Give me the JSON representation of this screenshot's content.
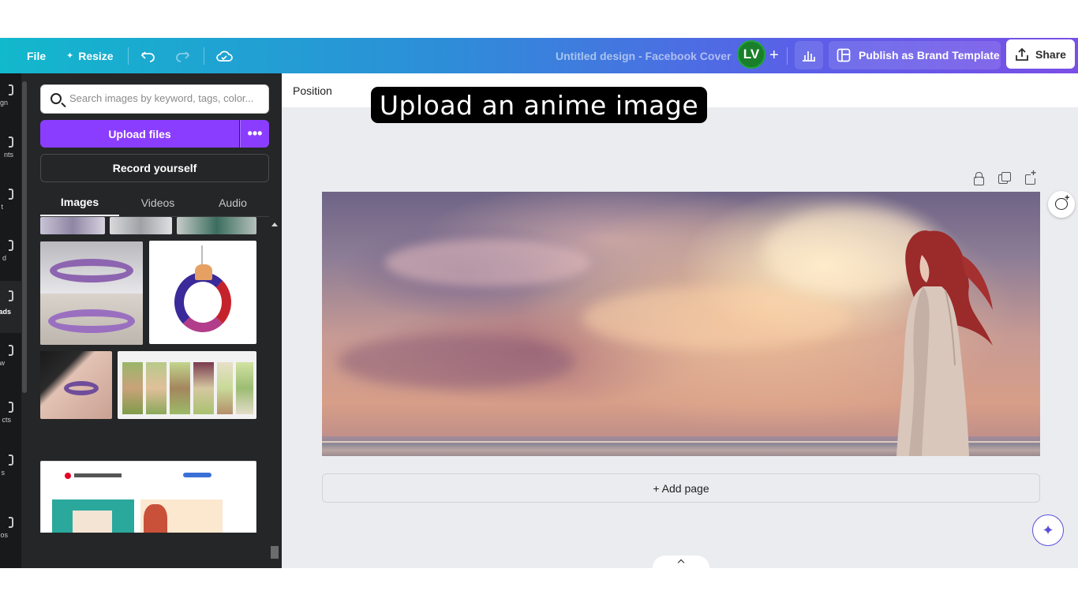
{
  "topbar": {
    "file_label": "File",
    "resize_label": "Resize",
    "design_title": "Untitled design - Facebook Cover",
    "avatar_initials": "LV",
    "publish_label": "Publish as Brand Template",
    "share_label": "Share"
  },
  "rail": {
    "items": [
      "gn",
      "nts",
      "t",
      "d",
      "ads",
      "w",
      "cts",
      "s",
      "os"
    ],
    "active_index": 4
  },
  "panel": {
    "search_placeholder": "Search images by keyword, tags, color...",
    "upload_label": "Upload files",
    "more_label": "•••",
    "record_label": "Record yourself",
    "tabs": [
      "Images",
      "Videos",
      "Audio"
    ],
    "active_tab": "Images"
  },
  "canvas": {
    "context_label": "Position",
    "add_page_label": "+ Add page"
  },
  "overlay": {
    "caption": "Upload an anime image"
  },
  "colors": {
    "accent_purple": "#8b3dff",
    "panel_bg": "#252627",
    "canvas_bg": "#ebecf0"
  }
}
